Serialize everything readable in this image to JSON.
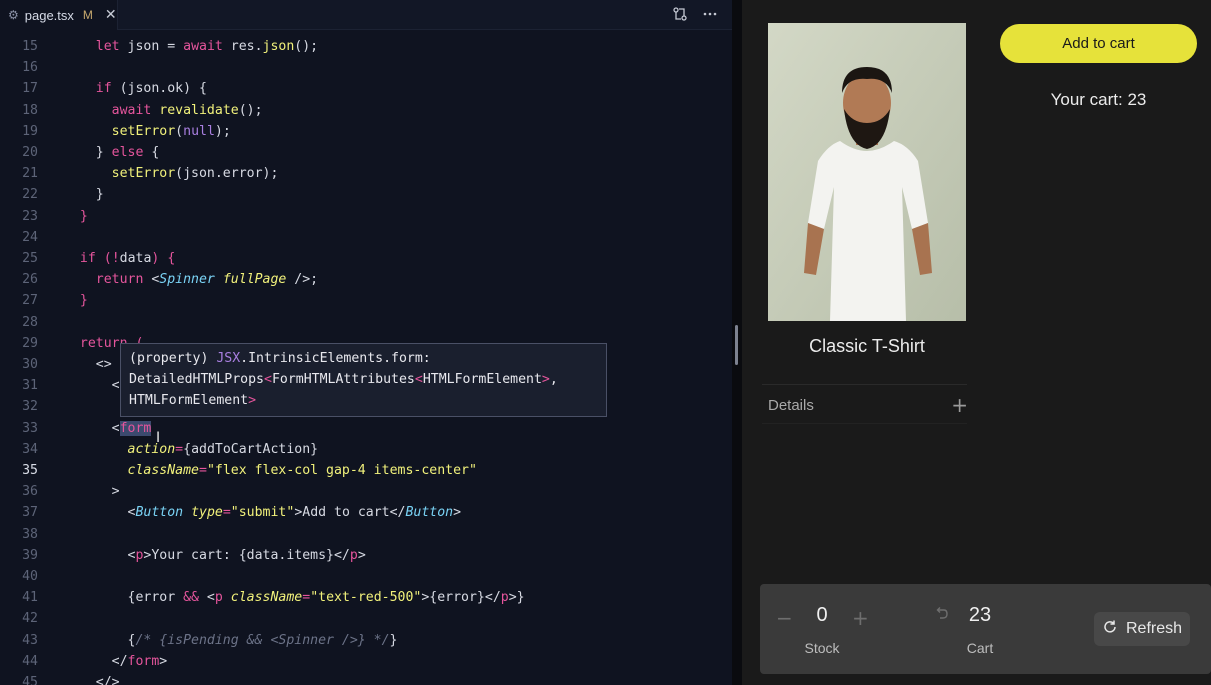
{
  "editor": {
    "tab": {
      "filename": "page.tsx",
      "status": "M",
      "icon": "gear-icon"
    },
    "actions": [
      "compare-changes-icon",
      "more-actions-icon"
    ],
    "current_line": 35,
    "hover": {
      "line1a": "(property) ",
      "line1b": "JSX",
      "line1c": ".IntrinsicElements.form:",
      "line2a": "DetailedHTMLProps",
      "line2b": "<",
      "line2c": "FormHTMLAttributes",
      "line2d": "<",
      "line2e": "HTMLFormElement",
      "line2f": ">, ",
      "line3a": "HTMLFormElement",
      "line3b": ">"
    }
  },
  "preview": {
    "add_to_cart_label": "Add to cart",
    "cart_text": "Your cart: 23",
    "product_title": "Classic T-Shirt",
    "details_label": "Details",
    "details_plus": "+",
    "stock_value": "0",
    "stock_label": "Stock",
    "cart_value": "23",
    "cart_label": "Cart",
    "refresh_label": "Refresh",
    "minus": "−",
    "plus": "+",
    "colors": {
      "accent": "#e6e23a",
      "panel": "#3a3a3a"
    }
  }
}
